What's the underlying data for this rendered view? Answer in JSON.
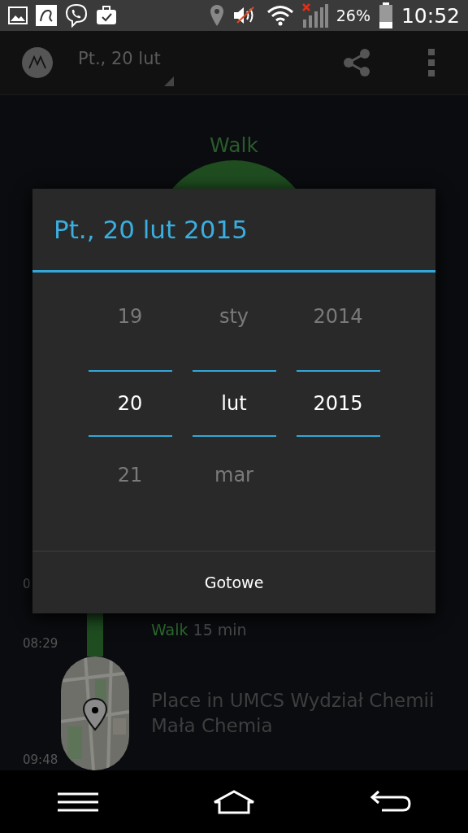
{
  "status_bar": {
    "battery": "26%",
    "time": "10:52"
  },
  "app_bar": {
    "date": "Pt., 20 lut"
  },
  "activity_label": "Walk",
  "timeline": {
    "times": [
      "0",
      "08:29",
      "09:48"
    ],
    "segment": {
      "activity": "Walk",
      "duration": "15 min"
    },
    "place": {
      "lines": [
        "Place in UMCS Wydział Chemii",
        "Mała Chemia"
      ]
    }
  },
  "dialog": {
    "title": "Pt., 20 lut 2015",
    "columns": [
      {
        "items": [
          {
            "text": "19",
            "selected": false
          },
          {
            "text": "20",
            "selected": true
          },
          {
            "text": "21",
            "selected": false
          }
        ]
      },
      {
        "items": [
          {
            "text": "sty",
            "selected": false
          },
          {
            "text": "lut",
            "selected": true
          },
          {
            "text": "mar",
            "selected": false
          }
        ]
      },
      {
        "items": [
          {
            "text": "2014",
            "selected": false
          },
          {
            "text": "2015",
            "selected": true
          }
        ]
      }
    ],
    "button": "Gotowe"
  }
}
